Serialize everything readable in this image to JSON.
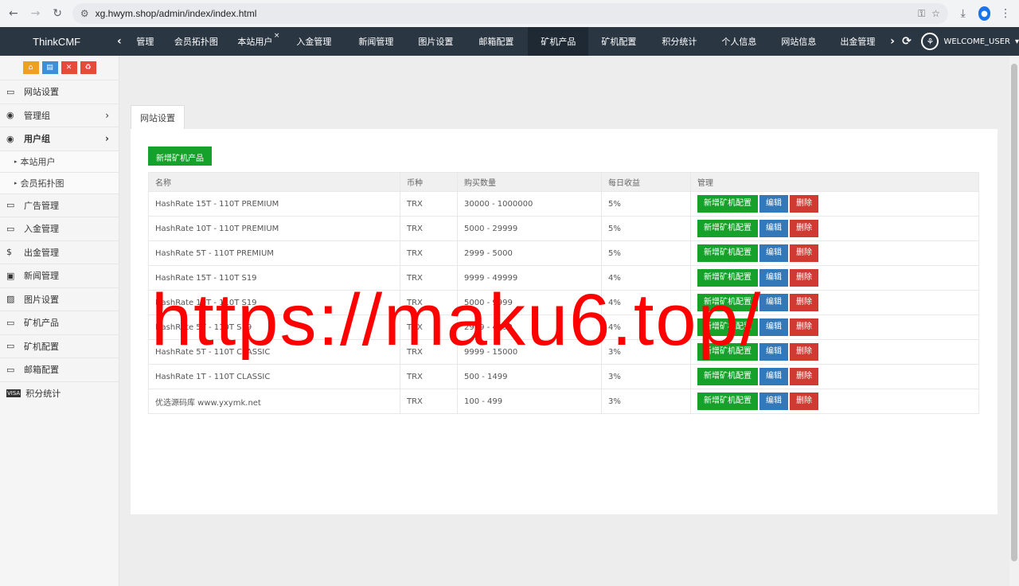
{
  "browser": {
    "url": "xg.hwym.shop/admin/index/index.html"
  },
  "topbar": {
    "brand": "ThinkCMF",
    "tabs": [
      {
        "label": "管理",
        "width": 50
      },
      {
        "label": "会员拓扑图",
        "width": 78
      },
      {
        "label": "本站用户",
        "width": 70,
        "closable": true
      },
      {
        "label": "入金管理",
        "width": 78
      },
      {
        "label": "新闻管理",
        "width": 78
      },
      {
        "label": "图片设置",
        "width": 72
      },
      {
        "label": "邮箱配置",
        "width": 80
      },
      {
        "label": "矿机产品",
        "width": 76,
        "active": true
      },
      {
        "label": "矿机配置",
        "width": 76
      },
      {
        "label": "积分统计",
        "width": 76
      },
      {
        "label": "个人信息",
        "width": 74
      },
      {
        "label": "网站信息",
        "width": 76
      },
      {
        "label": "出金管理",
        "width": 72
      }
    ],
    "welcome": "WELCOME_USER"
  },
  "sidebar": {
    "quick_buttons": [
      {
        "icon": "home-icon",
        "glyph": "⌂",
        "color": "#f0a020"
      },
      {
        "icon": "file-icon",
        "glyph": "▤",
        "color": "#3d8fd8"
      },
      {
        "icon": "trash-icon",
        "glyph": "✕",
        "color": "#e64a3b"
      },
      {
        "icon": "recycle-icon",
        "glyph": "♻",
        "color": "#e64a3b"
      }
    ],
    "items": [
      {
        "label": "网站设置",
        "icon": "monitor-icon",
        "glyph": "▭"
      },
      {
        "label": "管理组",
        "icon": "user-circle-icon",
        "glyph": "◉",
        "chevron": true
      },
      {
        "label": "用户组",
        "icon": "user-circle-icon",
        "glyph": "◉",
        "chevron": true,
        "bold": true
      },
      {
        "label": "本站用户",
        "sub": true
      },
      {
        "label": "会员拓扑图",
        "sub": true
      },
      {
        "label": "广告管理",
        "icon": "monitor-icon",
        "glyph": "▭"
      },
      {
        "label": "入金管理",
        "icon": "monitor-icon",
        "glyph": "▭"
      },
      {
        "label": "出金管理",
        "icon": "dollar-icon",
        "glyph": "$"
      },
      {
        "label": "新闻管理",
        "icon": "newspaper-icon",
        "glyph": "▣"
      },
      {
        "label": "图片设置",
        "icon": "image-icon",
        "glyph": "▨"
      },
      {
        "label": "矿机产品",
        "icon": "monitor-icon",
        "glyph": "▭"
      },
      {
        "label": "矿机配置",
        "icon": "monitor-icon",
        "glyph": "▭"
      },
      {
        "label": "邮箱配置",
        "icon": "monitor-icon",
        "glyph": "▭"
      },
      {
        "label": "积分统计",
        "icon": "visa-icon",
        "glyph": "VISA"
      }
    ]
  },
  "main": {
    "tab_label": "网站设置",
    "add_button": "新增矿机产品",
    "columns": [
      "名称",
      "币种",
      "购买数量",
      "每日收益",
      "管理"
    ],
    "rows": [
      [
        "HashRate 15T - 110T PREMIUM",
        "TRX",
        "30000 - 1000000",
        "5%"
      ],
      [
        "HashRate 10T - 110T PREMIUM",
        "TRX",
        "5000 - 29999",
        "5%"
      ],
      [
        "HashRate 5T - 110T PREMIUM",
        "TRX",
        "2999 - 5000",
        "5%"
      ],
      [
        "HashRate 15T - 110T S19",
        "TRX",
        "9999 - 49999",
        "4%"
      ],
      [
        "HashRate 10T - 110T S19",
        "TRX",
        "5000 - 9999",
        "4%"
      ],
      [
        "HashRate 5T - 110T S19",
        "TRX",
        "2999 - 4999",
        "4%"
      ],
      [
        "HashRate 5T - 110T CLASSIC",
        "TRX",
        "9999 - 15000",
        "3%"
      ],
      [
        "HashRate 1T - 110T CLASSIC",
        "TRX",
        "500 - 1499",
        "3%"
      ],
      [
        "优选源码库 www.yxymk.net",
        "TRX",
        "100 - 499",
        "3%"
      ]
    ],
    "actions": {
      "config": "新增矿机配置",
      "edit": "编辑",
      "delete": "删除"
    }
  },
  "watermark": "https://maku6.top/"
}
